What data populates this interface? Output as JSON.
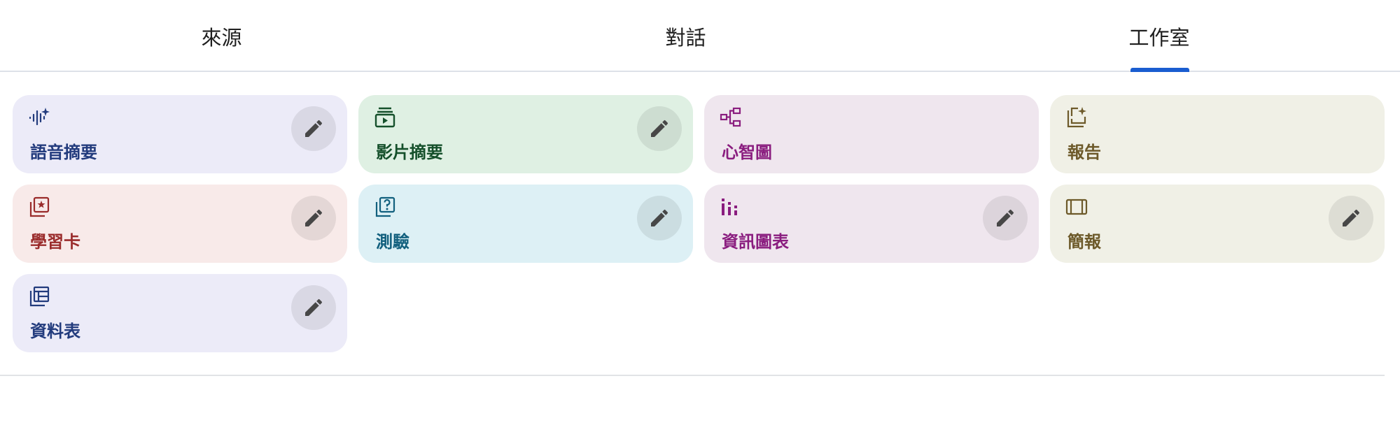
{
  "tabs": [
    {
      "label": "來源"
    },
    {
      "label": "對話"
    },
    {
      "label": "工作室",
      "selected": true
    }
  ],
  "colors": {
    "tab_indicator": "#1a5dd0",
    "edit_icon": "#474747"
  },
  "cards": [
    {
      "label": "語音摘要",
      "icon": "audio-sparkle-icon",
      "bg": "#ecebf8",
      "fg": "#223b7d",
      "editable": true
    },
    {
      "label": "影片摘要",
      "icon": "video-icon",
      "bg": "#dff0e3",
      "fg": "#15502b",
      "editable": true
    },
    {
      "label": "心智圖",
      "icon": "mind-map-icon",
      "bg": "#efe6ee",
      "fg": "#8a1d7f",
      "editable": false
    },
    {
      "label": "報告",
      "icon": "report-icon",
      "bg": "#f0f0e6",
      "fg": "#6d5a2a",
      "editable": false
    },
    {
      "label": "學習卡",
      "icon": "flashcard-icon",
      "bg": "#f8eae9",
      "fg": "#9a2b2b",
      "editable": true
    },
    {
      "label": "測驗",
      "icon": "quiz-icon",
      "bg": "#ddf0f5",
      "fg": "#12607e",
      "editable": true
    },
    {
      "label": "資訊圖表",
      "icon": "infographic-icon",
      "bg": "#efe6ee",
      "fg": "#8a1d7f",
      "editable": true
    },
    {
      "label": "簡報",
      "icon": "slides-icon",
      "bg": "#f0f0e6",
      "fg": "#6d5a2a",
      "editable": true
    },
    {
      "label": "資料表",
      "icon": "data-table-icon",
      "bg": "#ecebf8",
      "fg": "#223b7d",
      "editable": true
    }
  ]
}
